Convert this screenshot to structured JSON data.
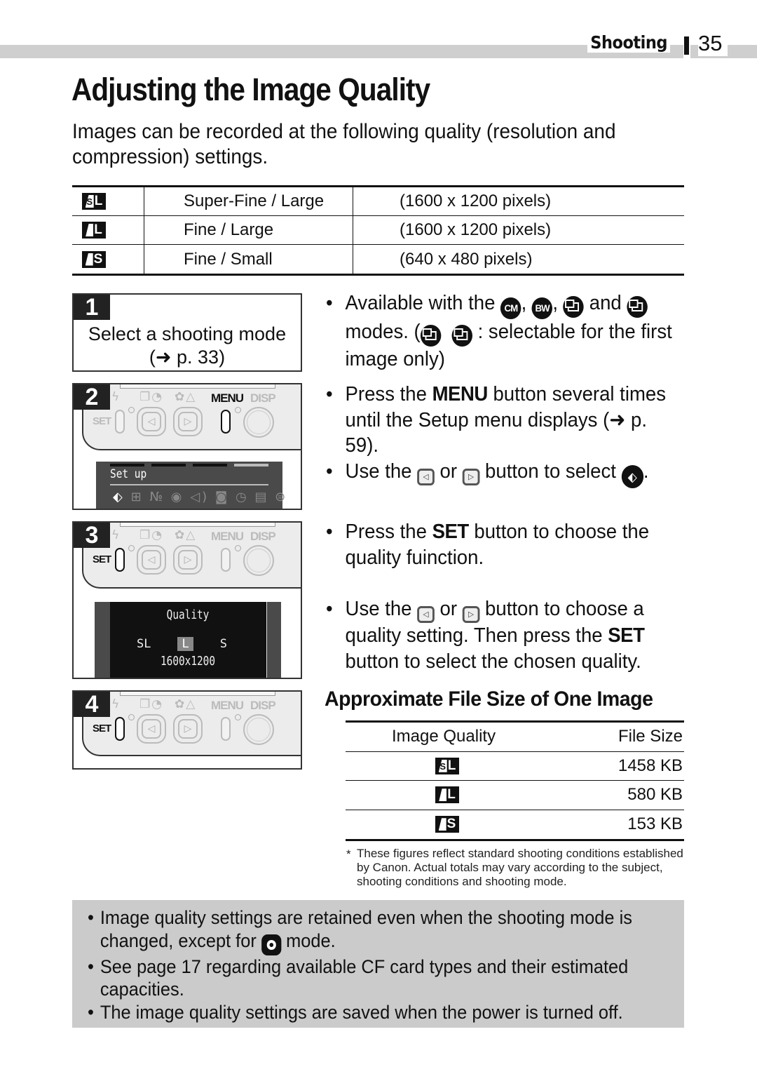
{
  "header": {
    "section": "Shooting",
    "page_number": "35"
  },
  "title": "Adjusting the Image Quality",
  "intro": "Images can be recorded at the following quality (resolution and compression) settings.",
  "quality_table": {
    "rows": [
      {
        "icon": "super-fine-large-icon",
        "icon_letter": "L",
        "icon_prefix": "S",
        "name": "Super-Fine / Large",
        "resolution": "(1600 x 1200 pixels)"
      },
      {
        "icon": "fine-large-icon",
        "icon_letter": "L",
        "name": "Fine / Large",
        "resolution": "(1600 x 1200 pixels)"
      },
      {
        "icon": "fine-small-icon",
        "icon_letter": "S",
        "name": "Fine / Small",
        "resolution": "(640 x 480 pixels)"
      }
    ]
  },
  "steps": [
    {
      "number": "1",
      "text_line1": "Select a shooting mode",
      "text_line2": "(➜ p. 33)"
    },
    {
      "number": "2",
      "lcd_title": "Set up",
      "highlighted_button": "MENU"
    },
    {
      "number": "3",
      "lcd_title": "Quality",
      "lcd_options": [
        "SL",
        "L",
        "S"
      ],
      "lcd_selected": "L",
      "lcd_resolution": "1600x1200",
      "highlighted_button": "SET"
    },
    {
      "number": "4",
      "highlighted_button": "SET"
    }
  ],
  "camera_labels": {
    "set": "SET",
    "menu": "MENU",
    "disp": "DISP"
  },
  "bullets": {
    "b1_a": "Available with the",
    "b1_icon1": "CM",
    "b1_icon2": "BW",
    "b1_b": "and",
    "b1_c": "modes. (",
    "b1_d": ": selectable for the first image only)",
    "b2_a": "Press the",
    "b2_kbd": "MENU",
    "b2_b": "button several times until the Setup menu displays (➜ p. 59).",
    "b2b_a": "Use the",
    "b2b_or": "or",
    "b2b_b": "button to select",
    "b3_a": "Press the",
    "b3_kbd": "SET",
    "b3_b": "button to choose the quality fuinction.",
    "b4_a": "Use the",
    "b4_or": "or",
    "b4_b": "button to choose a quality setting. Then press the",
    "b4_kbd": "SET",
    "b4_c": "button to select the chosen quality."
  },
  "file_size": {
    "title": "Approximate File Size of One Image",
    "headers": {
      "quality": "Image Quality",
      "size": "File Size"
    },
    "rows": [
      {
        "icon": "super-fine-large-icon",
        "size": "1458 KB"
      },
      {
        "icon": "fine-large-icon",
        "size": "580 KB"
      },
      {
        "icon": "fine-small-icon",
        "size": "153 KB"
      }
    ],
    "footnote": "These figures reflect standard shooting conditions established by Canon. Actual totals may vary according to the subject, shooting conditions and shooting mode."
  },
  "notes": {
    "n1_a": "Image quality settings are retained even when the shooting mode is changed, except for",
    "n1_b": "mode.",
    "n2": "See page 17 regarding available CF card types and their estimated capacities.",
    "n3": "The image quality settings are saved when the power is turned off."
  }
}
